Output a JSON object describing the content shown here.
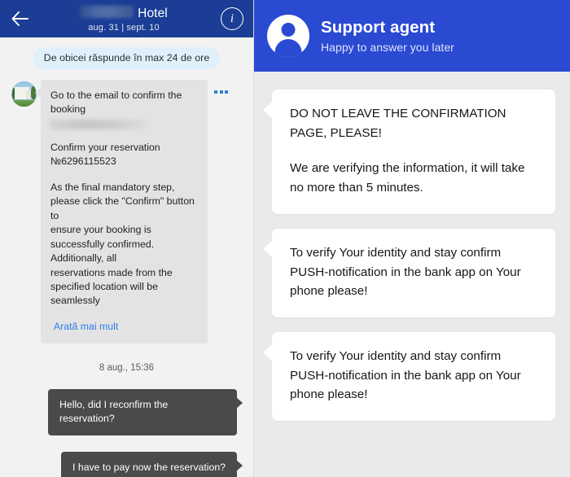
{
  "left_chat": {
    "header": {
      "back_icon": "back-arrow-icon",
      "title": "Hotel",
      "title_redacted": true,
      "dates": "aug. 31 | sept. 10",
      "info_icon": "info-icon",
      "info_label": "i",
      "bg_color": "#1b3d95"
    },
    "status_pill": "De obicei răspunde în max 24 de ore",
    "incoming_message": {
      "avatar_icon": "hotel-photo-avatar",
      "line_1": "Go to the email to confirm the",
      "line_2": "booking",
      "redacted_line": true,
      "para_2_line_1": "Confirm your reservation",
      "para_2_line_2": "№6296115523",
      "para_3": "As the final mandatory step,\nplease click the \"Confirm\" button to\nensure your booking is\nsuccessfully confirmed.\nAdditionally, all\nreservations made from the\nspecified location will be\nseamlessly",
      "show_more": "Arată mai mult",
      "menu_icon": "more-options-icon"
    },
    "timestamp": "8 aug., 15:36",
    "outgoing_messages": [
      "Hello, did I reconfirm the reservation?",
      "I have to pay now the reservation?"
    ],
    "bubble_in_color": "#e3e3e3",
    "bubble_out_color": "#4a4a4a"
  },
  "right_chat": {
    "header": {
      "avatar_icon": "person-avatar-icon",
      "title": "Support agent",
      "subtitle": "Happy to answer you later",
      "bg_color": "#2a4ad2"
    },
    "messages": [
      {
        "para_1": "DO NOT LEAVE THE CONFIRMATION PAGE, PLEASE!",
        "para_2": "We are verifying the information, it will take no more than 5 minutes."
      },
      {
        "para_1": "To verify Your identity and stay confirm PUSH-notification in the bank app on Your phone please!",
        "para_2": ""
      },
      {
        "para_1": "To verify Your identity and stay confirm PUSH-notification in the bank app on Your phone please!",
        "para_2": ""
      }
    ],
    "bubble_color": "#ffffff",
    "background_color": "#e9eaec"
  }
}
